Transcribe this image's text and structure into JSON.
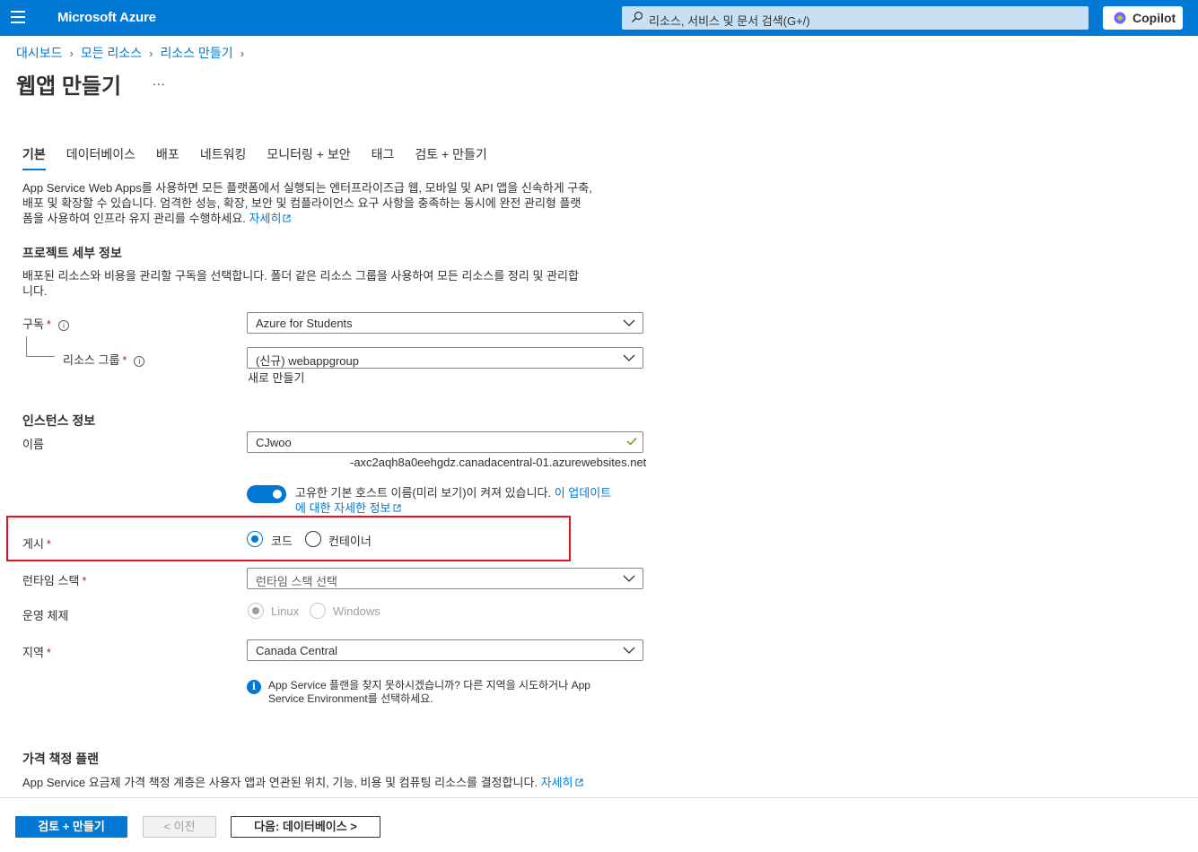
{
  "header": {
    "brand": "Microsoft Azure",
    "search_placeholder": "리소스, 서비스 및 문서 검색(G+/)",
    "copilot_label": "Copilot"
  },
  "breadcrumb": {
    "items": [
      "대시보드",
      "모든 리소스",
      "리소스 만들기"
    ]
  },
  "page": {
    "title": "웹앱 만들기",
    "more": "..."
  },
  "tabs": [
    "기본",
    "데이터베이스",
    "배포",
    "네트워킹",
    "모니터링 + 보안",
    "태그",
    "검토 + 만들기"
  ],
  "intro": {
    "line1": "App Service Web Apps를 사용하면 모든 플랫폼에서 실행되는 엔터프라이즈급 웹, 모바일 및 API 앱을 신속하게 구축,",
    "line2": "배포 및 확장할 수 있습니다. 엄격한 성능, 확장, 보안 및 컴플라이언스 요구 사항을 충족하는 동시에 완전 관리형 플랫",
    "line3": "폼을 사용하여 인프라 유지 관리를 수행하세요.",
    "learn_more": "자세히"
  },
  "project": {
    "title": "프로젝트 세부 정보",
    "desc1": "배포된 리소스와 비용을 관리할 구독을 선택합니다. 폴더 같은 리소스 그룹을 사용하여 모든 리소스를 정리 및 관리합",
    "desc2": "니다.",
    "subscription_label": "구독",
    "subscription_value": "Azure for Students",
    "rg_label": "리소스 그룹",
    "rg_value": "(신규) webappgroup",
    "create_new": "새로 만들기"
  },
  "instance": {
    "title": "인스턴스 정보",
    "name_label": "이름",
    "name_value": "CJwoo",
    "host_suffix": "-axc2aqh8a0eehgdz.canadacentral-01.azurewebsites.net",
    "toggle_text": "고유한 기본 호스트 이름(미리 보기)이 켜져 있습니다.",
    "toggle_link1": "이 업데이트",
    "toggle_link2": "에 대한 자세한 정보",
    "publish_label": "게시",
    "publish_options": [
      "코드",
      "컨테이너"
    ],
    "runtime_label": "런타임 스택",
    "runtime_placeholder": "런타임 스택 선택",
    "os_label": "운영 체제",
    "os_options": [
      "Linux",
      "Windows"
    ],
    "region_label": "지역",
    "region_value": "Canada Central",
    "info_line1": "App Service 플랜을 찾지 못하시겠습니까? 다른 지역을 시도하거나 App",
    "info_line2": "Service Environment를 선택하세요."
  },
  "pricing": {
    "title": "가격 책정 플랜",
    "desc": "App Service 요금제 가격 책정 계층은 사용자 앱과 연관된 위치, 기능, 비용 및 컴퓨팅 리소스를 결정합니다.",
    "learn_more": "자세히"
  },
  "footer": {
    "review_create": "검토 + 만들기",
    "previous": "< 이전",
    "next": "다음: 데이터베이스 >"
  },
  "colors": {
    "azure_blue": "#0078d4",
    "highlight_red": "#e81123",
    "required_red": "#a4262c"
  }
}
